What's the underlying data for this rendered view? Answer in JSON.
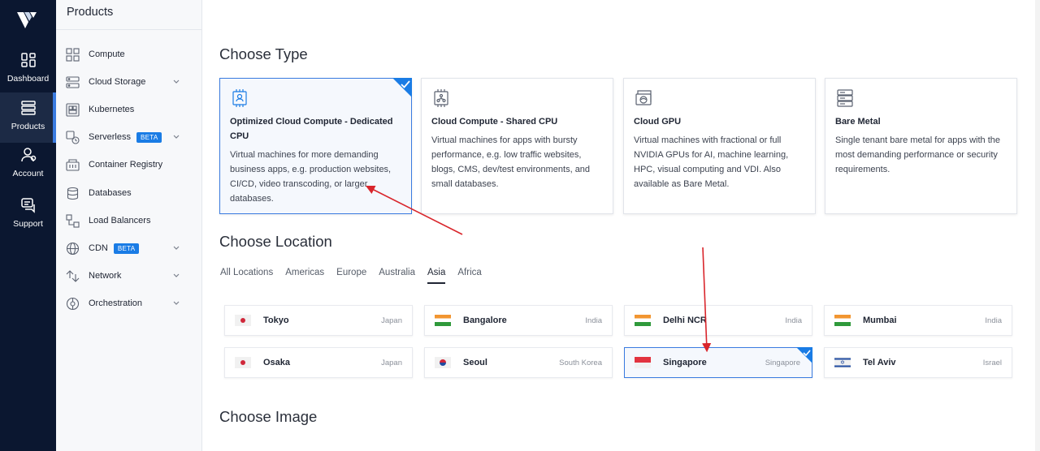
{
  "rail": {
    "items": [
      {
        "label": "Dashboard",
        "icon": "dashboard-icon"
      },
      {
        "label": "Products",
        "icon": "products-icon"
      },
      {
        "label": "Account",
        "icon": "account-icon"
      },
      {
        "label": "Support",
        "icon": "support-icon"
      }
    ]
  },
  "products": {
    "title": "Products",
    "items": [
      {
        "label": "Compute",
        "icon": "compute-icon"
      },
      {
        "label": "Cloud Storage",
        "icon": "cloud-storage-icon"
      },
      {
        "label": "Kubernetes",
        "icon": "kubernetes-icon"
      },
      {
        "label": "Serverless",
        "icon": "serverless-icon",
        "badge": "BETA"
      },
      {
        "label": "Container Registry",
        "icon": "container-registry-icon"
      },
      {
        "label": "Databases",
        "icon": "databases-icon"
      },
      {
        "label": "Load Balancers",
        "icon": "load-balancers-icon"
      },
      {
        "label": "CDN",
        "icon": "cdn-icon",
        "badge": "BETA"
      },
      {
        "label": "Network",
        "icon": "network-icon"
      },
      {
        "label": "Orchestration",
        "icon": "orchestration-icon"
      }
    ]
  },
  "main": {
    "choose_type_title": "Choose Type",
    "types": [
      {
        "name": "Optimized Cloud Compute - Dedicated CPU",
        "desc": "Virtual machines for more demanding business apps, e.g. production websites, CI/CD, video transcoding, or larger databases.",
        "selected": true
      },
      {
        "name": "Cloud Compute - Shared CPU",
        "desc": "Virtual machines for apps with bursty performance, e.g. low traffic websites, blogs, CMS, dev/test environments, and small databases."
      },
      {
        "name": "Cloud GPU",
        "desc": "Virtual machines with fractional or full NVIDIA GPUs for AI, machine learning, HPC, visual computing and VDI. Also available as Bare Metal."
      },
      {
        "name": "Bare Metal",
        "desc": "Single tenant bare metal for apps with the most demanding performance or security requirements."
      }
    ],
    "choose_location_title": "Choose Location",
    "location_tabs": [
      "All Locations",
      "Americas",
      "Europe",
      "Australia",
      "Asia",
      "Africa"
    ],
    "active_tab": "Asia",
    "locations": [
      {
        "city": "Tokyo",
        "country": "Japan",
        "flag": "jp"
      },
      {
        "city": "Bangalore",
        "country": "India",
        "flag": "in"
      },
      {
        "city": "Delhi NCR",
        "country": "India",
        "flag": "in"
      },
      {
        "city": "Mumbai",
        "country": "India",
        "flag": "in"
      },
      {
        "city": "Osaka",
        "country": "Japan",
        "flag": "jp"
      },
      {
        "city": "Seoul",
        "country": "South Korea",
        "flag": "kr"
      },
      {
        "city": "Singapore",
        "country": "Singapore",
        "flag": "sg",
        "selected": true
      },
      {
        "city": "Tel Aviv",
        "country": "Israel",
        "flag": "il"
      }
    ],
    "choose_image_title": "Choose Image"
  },
  "colors": {
    "rail_bg": "#0b1730",
    "accent": "#3a7be0",
    "beta_badge": "#1a7ce5",
    "annotation_arrow": "#d9262c"
  }
}
